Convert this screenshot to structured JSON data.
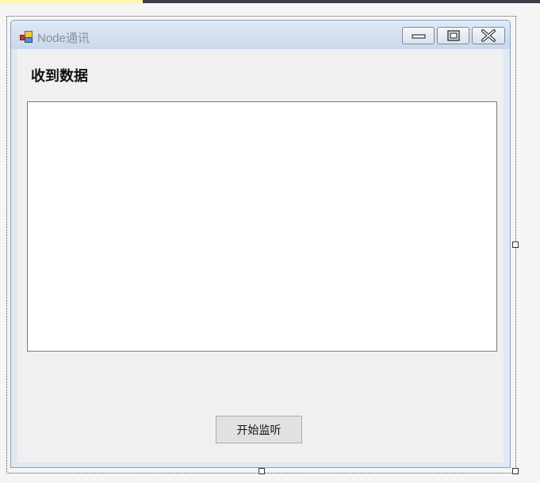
{
  "window": {
    "title": "Node通讯",
    "app_icon": "winforms-app-icon",
    "controls": {
      "minimize_icon": "minimize-icon",
      "maximize_icon": "maximize-icon",
      "close_icon": "close-icon"
    }
  },
  "form": {
    "received_label": "收到数据",
    "received_text": "",
    "listen_button_label": "开始监听"
  },
  "colors": {
    "titlebar": "#c9d8ea",
    "form_background": "#f0f0f0",
    "textbox_background": "#ffffff",
    "button_background": "#e1e1e1"
  }
}
